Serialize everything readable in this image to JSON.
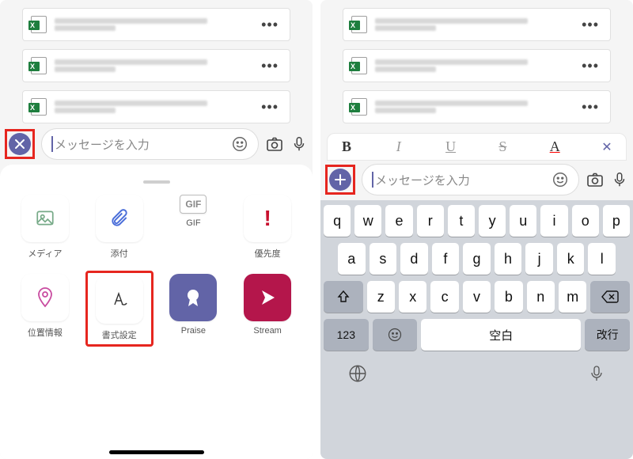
{
  "compose": {
    "placeholder": "メッセージを入力"
  },
  "actions": {
    "media": {
      "label": "メディア"
    },
    "attach": {
      "label": "添付"
    },
    "gif": {
      "label": "GIF",
      "tile_text": "GIF"
    },
    "priority": {
      "label": "優先度"
    },
    "location": {
      "label": "位置情報"
    },
    "format": {
      "label": "書式設定"
    },
    "praise": {
      "label": "Praise"
    },
    "stream": {
      "label": "Stream"
    }
  },
  "format_toolbar": {
    "bold": "B",
    "italic": "I",
    "underline": "U",
    "strike": "S",
    "color": "A"
  },
  "keyboard": {
    "row1": [
      "q",
      "w",
      "e",
      "r",
      "t",
      "y",
      "u",
      "i",
      "o",
      "p"
    ],
    "row2": [
      "a",
      "s",
      "d",
      "f",
      "g",
      "h",
      "j",
      "k",
      "l"
    ],
    "row3": [
      "z",
      "x",
      "c",
      "v",
      "b",
      "n",
      "m"
    ],
    "num": "123",
    "space": "空白",
    "return": "改行"
  }
}
